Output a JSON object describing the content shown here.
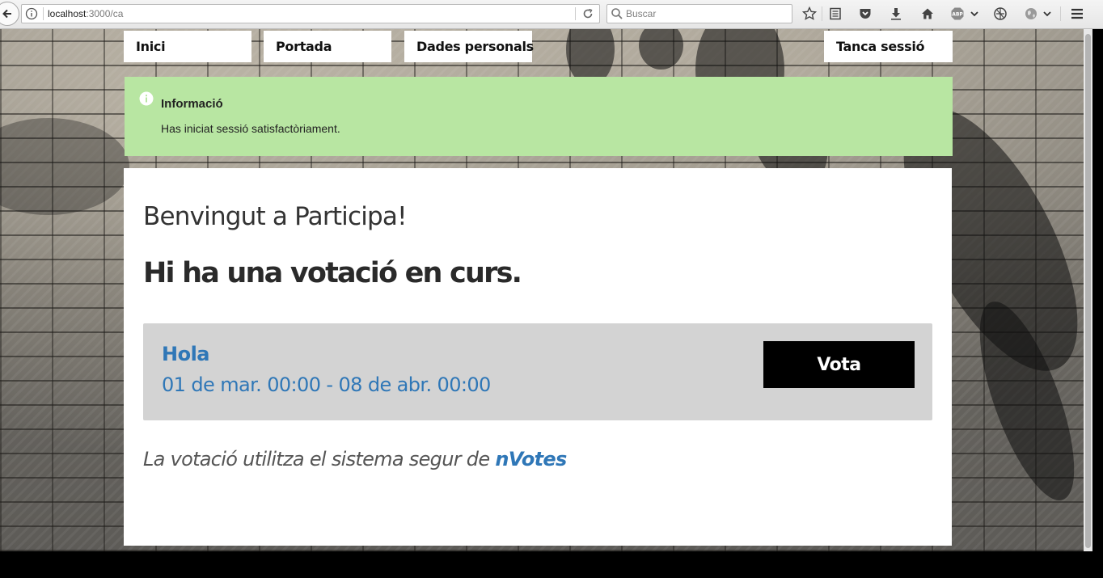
{
  "browser": {
    "url_host": "localhost",
    "url_path": ":3000/ca",
    "search_placeholder": "Buscar"
  },
  "nav": {
    "items": [
      "Inici",
      "Portada",
      "Dades personals"
    ],
    "logout": "Tanca sessió"
  },
  "callout": {
    "title": "Informació",
    "message": "Has iniciat sessió satisfactòriament."
  },
  "main": {
    "welcome": "Benvingut a Participa!",
    "heading": "Hi ha una votació en curs.",
    "election": {
      "name": "Hola",
      "dates": "01 de mar. 00:00 - 08 de abr. 00:00",
      "vote_label": "Vota"
    },
    "secure_text": "La votació utilitza el sistema segur de",
    "secure_link": "nVotes"
  },
  "colors": {
    "callout_bg": "#b8e6a2",
    "link": "#2f77b7",
    "vote_button_bg": "#000000"
  }
}
